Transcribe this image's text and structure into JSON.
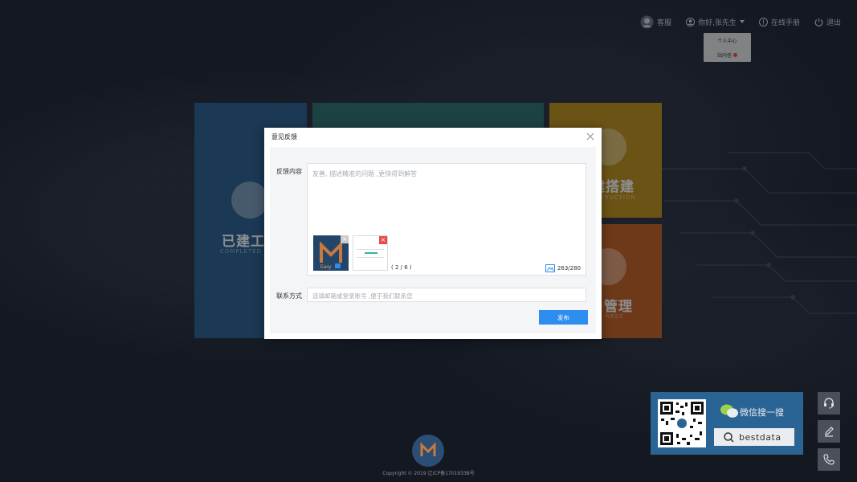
{
  "topbar": {
    "service": "客服",
    "greeting": "你好,张先生",
    "manual": "在线手册",
    "logout": "退出"
  },
  "user_menu": {
    "items": [
      "个人中心",
      "站内信"
    ]
  },
  "tiles": [
    {
      "title": "已建工",
      "sub": "COMPLETED W"
    },
    {
      "title": "",
      "sub": ""
    },
    {
      "title": "建搭建",
      "sub": "STRUCTION"
    },
    {
      "title": "管理",
      "sub": "NESS"
    }
  ],
  "modal": {
    "title": "意见反馈",
    "feedback_label": "反馈内容",
    "feedback_placeholder": "友善, 描述精准的问题 ,更快得到解答",
    "image_count": "( 2 / 6 )",
    "char_counter": "263/280",
    "contact_label": "联系方式",
    "contact_placeholder": "选填邮箱或登录账号 ,便于我们联系您",
    "submit": "发布"
  },
  "bottom": {
    "copyright": "Copyright © 2019 辽ICP备17019338号"
  },
  "wechat": {
    "label": "微信搜一搜",
    "search_text": "bestdata"
  },
  "colors": {
    "accent": "#2d8ef0",
    "close_red": "#e94b4b",
    "panel_blue": "#2a6494"
  }
}
